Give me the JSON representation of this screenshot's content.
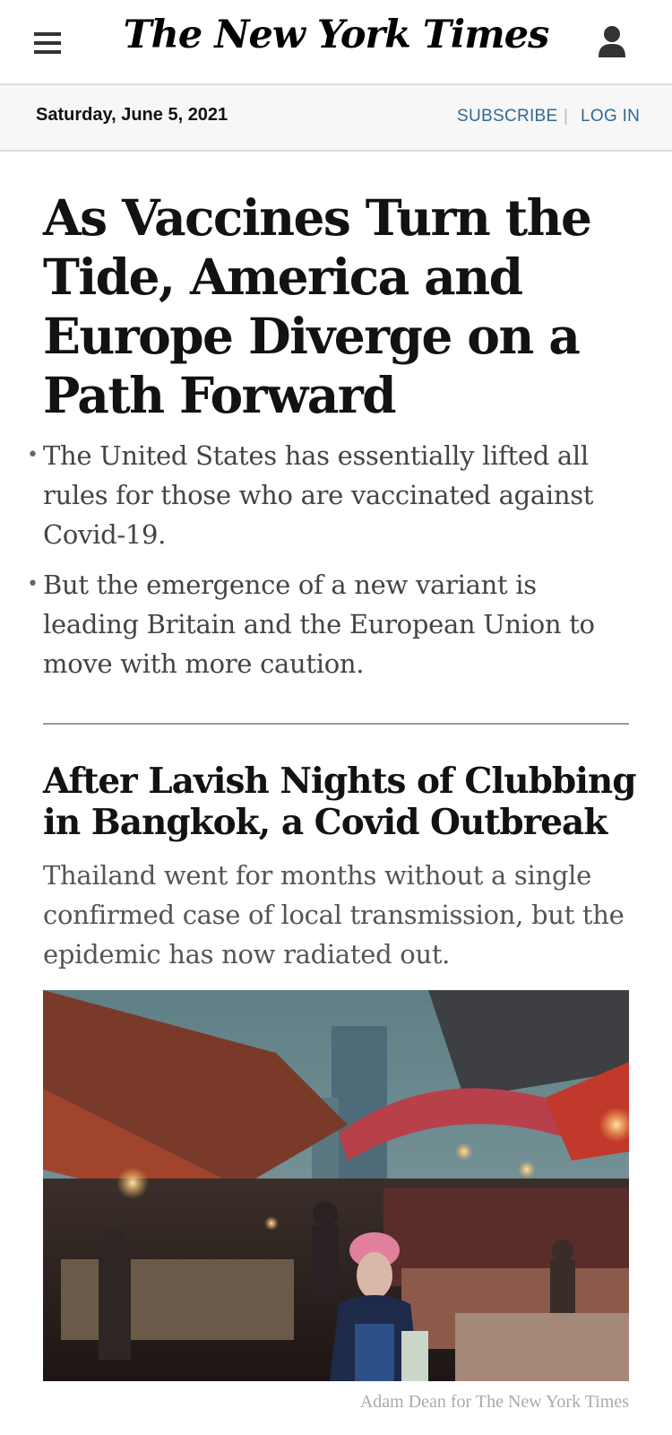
{
  "masthead": {
    "logo_text": "The New York Times",
    "menu_icon": "hamburger-menu-icon",
    "account_icon": "user-account-icon"
  },
  "subbar": {
    "date": "Saturday, June 5, 2021",
    "subscribe_label": "SUBSCRIBE",
    "separator": "|",
    "login_label": "LOG IN"
  },
  "lead_story": {
    "headline": "As Vaccines Turn the Tide, America and Europe Diverge on a Path Forward",
    "bullets": [
      "The United States has essentially lifted all rules for those who are vaccinated against Covid-19.",
      "But the emergence of a new variant is leading Britain and the European Union to move with more caution."
    ]
  },
  "second_story": {
    "headline": "After Lavish Nights of Clubbing in Bangkok, a Covid Outbreak",
    "summary": "Thailand went for months without a single confirmed case of local transmission, but the epidemic has now radiated out.",
    "photo_credit": "Adam Dean for The New York Times"
  },
  "colors": {
    "link_blue": "#326891",
    "subbar_bg": "#f7f7f7",
    "summary_gray": "#555555"
  }
}
